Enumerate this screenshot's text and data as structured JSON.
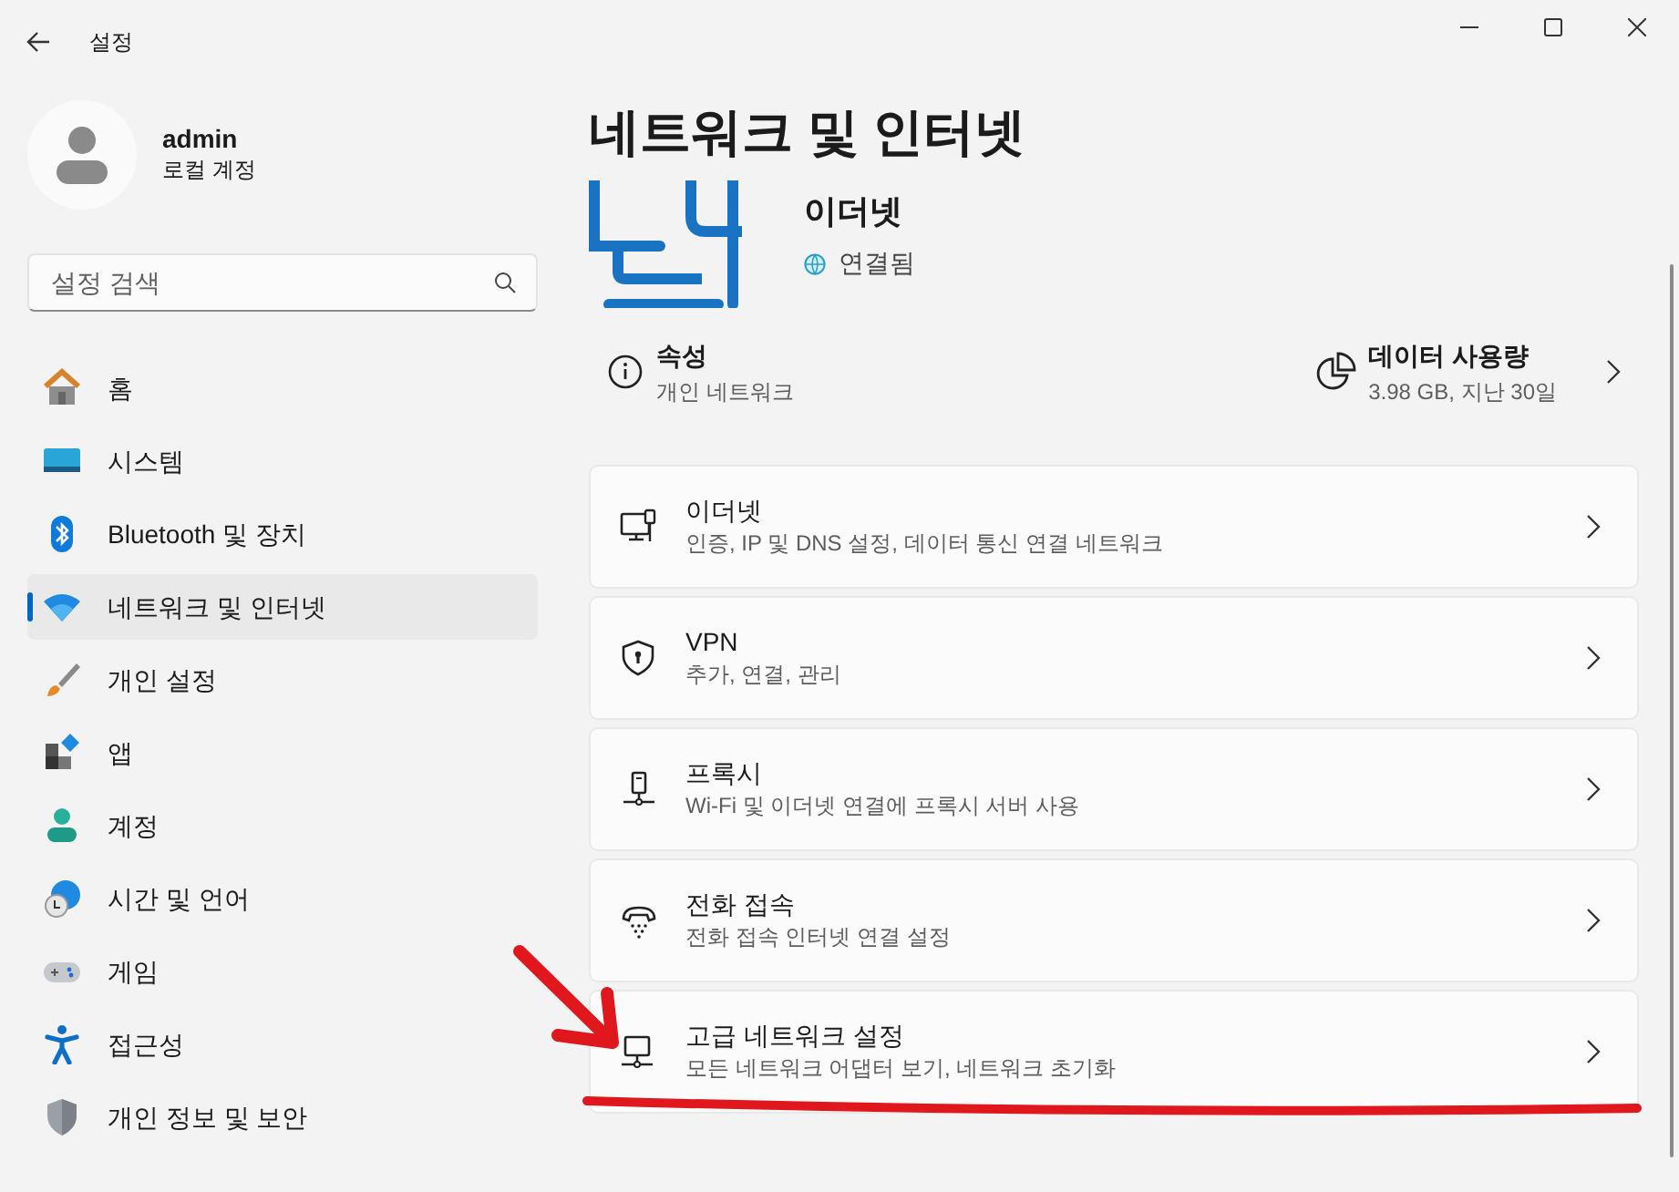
{
  "window": {
    "title": "설정"
  },
  "profile": {
    "name": "admin",
    "account_type": "로컬 계정"
  },
  "search": {
    "placeholder": "설정 검색"
  },
  "sidebar": {
    "items": [
      {
        "label": "홈",
        "selected": false
      },
      {
        "label": "시스템",
        "selected": false
      },
      {
        "label": "Bluetooth 및 장치",
        "selected": false
      },
      {
        "label": "네트워크 및 인터넷",
        "selected": true
      },
      {
        "label": "개인 설정",
        "selected": false
      },
      {
        "label": "앱",
        "selected": false
      },
      {
        "label": "계정",
        "selected": false
      },
      {
        "label": "시간 및 언어",
        "selected": false
      },
      {
        "label": "게임",
        "selected": false
      },
      {
        "label": "접근성",
        "selected": false
      },
      {
        "label": "개인 정보 및 보안",
        "selected": false
      }
    ]
  },
  "page": {
    "title": "네트워크 및 인터넷",
    "connection": {
      "name": "이더넷",
      "status": "연결됨"
    },
    "properties": {
      "title": "속성",
      "subtitle": "개인 네트워크"
    },
    "data_usage": {
      "title": "데이터 사용량",
      "subtitle": "3.98 GB, 지난 30일"
    },
    "cards": [
      {
        "title": "이더넷",
        "subtitle": "인증, IP 및 DNS 설정, 데이터 통신 연결 네트워크"
      },
      {
        "title": "VPN",
        "subtitle": "추가, 연결, 관리"
      },
      {
        "title": "프록시",
        "subtitle": "Wi-Fi 및 이더넷 연결에 프록시 서버 사용"
      },
      {
        "title": "전화 접속",
        "subtitle": "전화 접속 인터넷 연결 설정"
      },
      {
        "title": "고급 네트워크 설정",
        "subtitle": "모든 네트워크 어댑터 보기, 네트워크 초기화"
      }
    ]
  }
}
